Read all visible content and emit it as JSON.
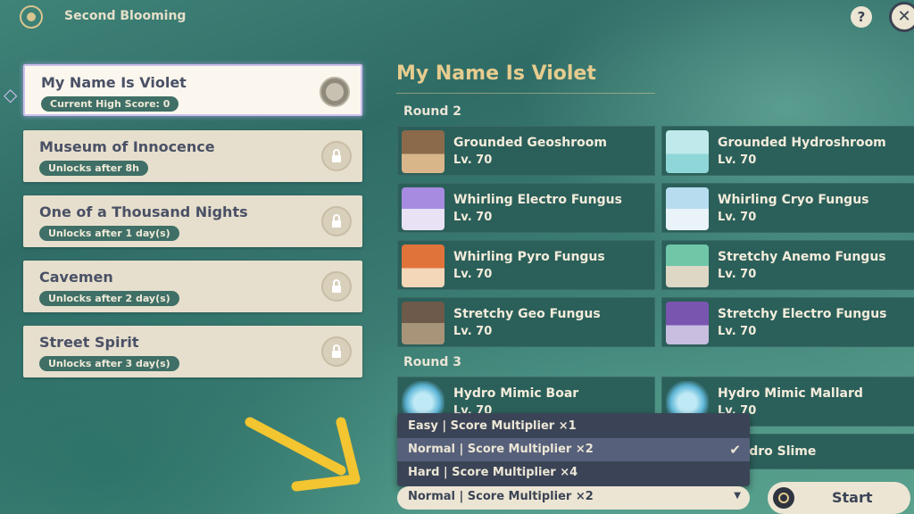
{
  "header": {
    "title": "Second Blooming",
    "help_label": "?",
    "close_label": "✕"
  },
  "stages": [
    {
      "name": "My Name Is Violet",
      "status": "Current High Score: 0",
      "state": "active"
    },
    {
      "name": "Museum of Innocence",
      "status": "Unlocks after 8h",
      "state": "locked"
    },
    {
      "name": "One of a Thousand Nights",
      "status": "Unlocks after 1 day(s)",
      "state": "locked"
    },
    {
      "name": "Cavemen",
      "status": "Unlocks after 2 day(s)",
      "state": "locked"
    },
    {
      "name": "Street Spirit",
      "status": "Unlocks after 3 day(s)",
      "state": "locked"
    }
  ],
  "detail": {
    "title": "My Name Is Violet",
    "rounds": [
      {
        "label": "Round 2",
        "enemies": [
          {
            "name": "Grounded Geoshroom",
            "level": "Lv. 70",
            "icon": "geoshroom-icon",
            "color": "#8a6a4a"
          },
          {
            "name": "Grounded Hydroshroom",
            "level": "Lv. 70",
            "icon": "hydroshroom-icon",
            "color": "#8fd6d8"
          },
          {
            "name": "Whirling Electro Fungus",
            "level": "Lv. 70",
            "icon": "electro-fungus-icon",
            "color": "#a78be0"
          },
          {
            "name": "Whirling Cryo Fungus",
            "level": "Lv. 70",
            "icon": "cryo-fungus-icon",
            "color": "#b7dcef"
          },
          {
            "name": "Whirling Pyro Fungus",
            "level": "Lv. 70",
            "icon": "pyro-fungus-icon",
            "color": "#e0733a"
          },
          {
            "name": "Stretchy Anemo Fungus",
            "level": "Lv. 70",
            "icon": "anemo-fungus-icon",
            "color": "#6fc7a8"
          },
          {
            "name": "Stretchy Geo Fungus",
            "level": "Lv. 70",
            "icon": "geo-fungus-icon",
            "color": "#6e5a4a"
          },
          {
            "name": "Stretchy Electro Fungus",
            "level": "Lv. 70",
            "icon": "electro-fungus-icon",
            "color": "#7a55b0"
          }
        ]
      },
      {
        "label": "Round 3",
        "enemies": [
          {
            "name": "Hydro Mimic Boar",
            "level": "Lv. 70",
            "icon": "hydro-mimic-icon",
            "color": "#5fb6d8"
          },
          {
            "name": "Hydro Mimic Mallard",
            "level": "Lv. 70",
            "icon": "hydro-mimic-icon",
            "color": "#5fb6d8"
          },
          {
            "name": "e Hydro Slime",
            "level": "",
            "icon": "hydro-slime-icon",
            "color": "#5fb6d8"
          }
        ]
      }
    ]
  },
  "difficulty": {
    "options": [
      "Easy | Score Multiplier ×1",
      "Normal | Score Multiplier ×2",
      "Hard | Score Multiplier ×4"
    ],
    "selected_index": 1,
    "selected_value": "Normal | Score Multiplier ×2"
  },
  "start_label": "Start",
  "colors": {
    "accent_gold": "#e6cc8e",
    "card_bg": "#e7dfcd",
    "enemy_tile": "#2b5f5a",
    "dropdown_bg": "#3b4456",
    "hint_arrow": "#f2c531"
  }
}
